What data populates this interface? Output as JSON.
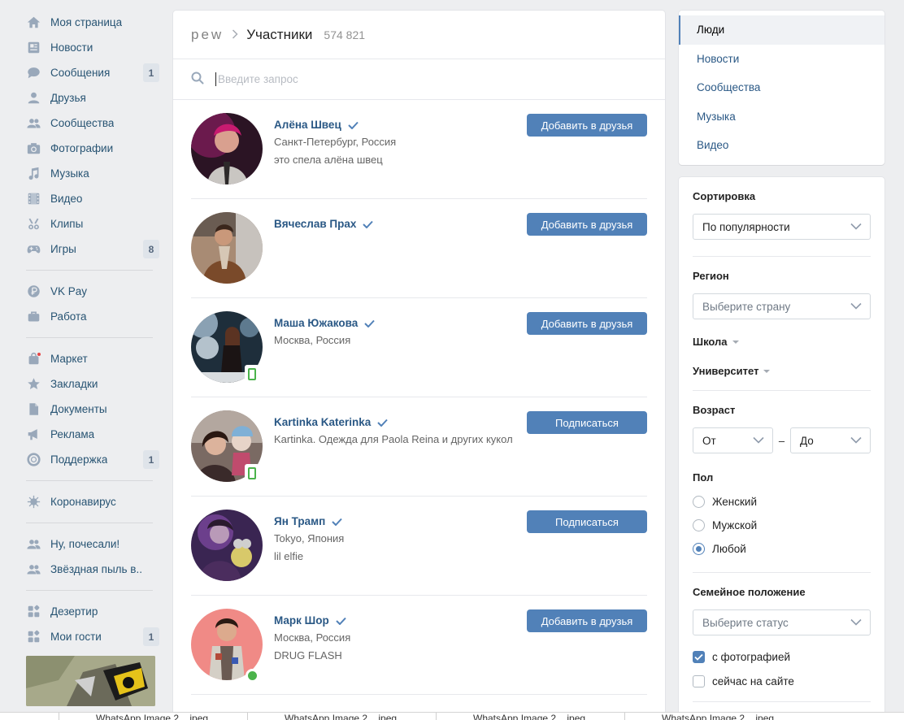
{
  "left_menu": {
    "items": [
      {
        "label": "Моя страница",
        "icon": "home-icon"
      },
      {
        "label": "Новости",
        "icon": "news-icon"
      },
      {
        "label": "Сообщения",
        "icon": "messages-icon",
        "badge": "1"
      },
      {
        "label": "Друзья",
        "icon": "user-icon"
      },
      {
        "label": "Сообщества",
        "icon": "groups-icon"
      },
      {
        "label": "Фотографии",
        "icon": "camera-icon"
      },
      {
        "label": "Музыка",
        "icon": "music-icon"
      },
      {
        "label": "Видео",
        "icon": "video-icon"
      },
      {
        "label": "Клипы",
        "icon": "clips-icon"
      },
      {
        "label": "Игры",
        "icon": "gamepad-icon",
        "badge": "8"
      }
    ],
    "items2": [
      {
        "label": "VK Pay",
        "icon": "vkpay-icon"
      },
      {
        "label": "Работа",
        "icon": "briefcase-icon"
      }
    ],
    "items3": [
      {
        "label": "Маркет",
        "icon": "market-icon"
      },
      {
        "label": "Закладки",
        "icon": "star-icon"
      },
      {
        "label": "Документы",
        "icon": "document-icon"
      },
      {
        "label": "Реклама",
        "icon": "megaphone-icon"
      },
      {
        "label": "Поддержка",
        "icon": "support-icon",
        "badge": "1"
      }
    ],
    "items4": [
      {
        "label": "Коронавирус",
        "icon": "virus-icon"
      }
    ],
    "items5": [
      {
        "label": "Ну, почесали!",
        "icon": "community-icon"
      },
      {
        "label": "Звёздная пыль в..",
        "icon": "community-icon"
      }
    ],
    "items6": [
      {
        "label": "Дезертир",
        "icon": "app-icon"
      },
      {
        "label": "Мои гости",
        "icon": "app-icon",
        "badge": "1"
      }
    ]
  },
  "header": {
    "group": "pew",
    "title": "Участники",
    "count": "574 821"
  },
  "search": {
    "placeholder": "Введите запрос",
    "value": ""
  },
  "people": [
    {
      "name": "Алёна Швец",
      "line1": "Санкт-Петербург, Россия",
      "line2": "это спела алёна швец",
      "button": "Добавить в друзья",
      "status": "none"
    },
    {
      "name": "Вячеслав Прах",
      "line1": "",
      "line2": "",
      "button": "Добавить в друзья",
      "status": "none"
    },
    {
      "name": "Маша Южакова",
      "line1": "Москва, Россия",
      "line2": "",
      "button": "Добавить в друзья",
      "status": "mobile"
    },
    {
      "name": "Kartinka Katerinka",
      "line1": "Kartinka. Одежда для Paola Reina и других кукол",
      "line2": "",
      "button": "Подписаться",
      "status": "mobile"
    },
    {
      "name": "Ян Трамп",
      "line1": "Tokyo, Япония",
      "line2": "lil elfie",
      "button": "Подписаться",
      "status": "none"
    },
    {
      "name": "Марк Шор",
      "line1": "Москва, Россия",
      "line2": "DRUG FLASH",
      "button": "Добавить в друзья",
      "status": "online"
    }
  ],
  "right_nav": {
    "items": [
      "Люди",
      "Новости",
      "Сообщества",
      "Музыка",
      "Видео"
    ],
    "active": "Люди"
  },
  "filters": {
    "sort_title": "Сортировка",
    "sort_value": "По популярности",
    "region_title": "Регион",
    "region_placeholder": "Выберите страну",
    "school": "Школа",
    "university": "Университет",
    "age_title": "Возраст",
    "age_from": "От",
    "age_dash": "–",
    "age_to": "До",
    "gender_title": "Пол",
    "gender_options": [
      "Женский",
      "Мужской",
      "Любой"
    ],
    "gender_selected": "Любой",
    "family_title": "Семейное положение",
    "family_placeholder": "Выберите статус",
    "with_photo": "с фотографией",
    "with_photo_checked": true,
    "online_now": "сейчас на сайте",
    "online_now_checked": false
  },
  "downloads": {
    "items": [
      "WhatsApp Image 2....jpeg",
      "WhatsApp Image 2....jpeg",
      "WhatsApp Image 2....jpeg",
      "WhatsApp Image 2....jpeg"
    ]
  },
  "colors": {
    "accent": "#5181b8",
    "link": "#2a5885",
    "background": "#edeef0",
    "online": "#4bb34b"
  }
}
